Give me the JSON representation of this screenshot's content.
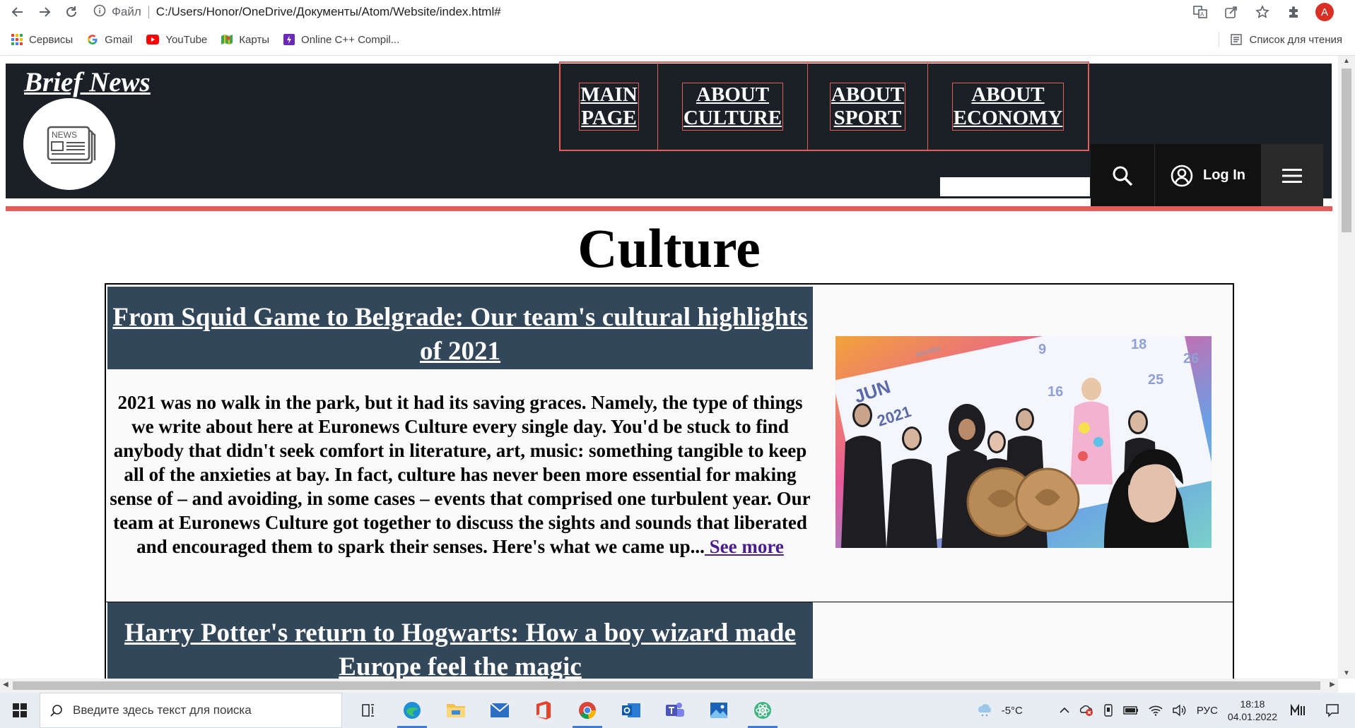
{
  "browser": {
    "file_label": "Файл",
    "url": "C:/Users/Honor/OneDrive/Документы/Atom/Website/index.html#",
    "avatar_letter": "A"
  },
  "bookmarks": {
    "items": [
      {
        "label": "Сервисы",
        "icon": "apps-grid-icon"
      },
      {
        "label": "Gmail",
        "icon": "google-icon"
      },
      {
        "label": "YouTube",
        "icon": "youtube-icon"
      },
      {
        "label": "Карты",
        "icon": "maps-icon"
      },
      {
        "label": "Online C++ Compil...",
        "icon": "compiler-icon"
      }
    ],
    "reading_list": "Список для чтения"
  },
  "site": {
    "brand": "Brief News",
    "logo_text": "NEWS",
    "menu": [
      {
        "label": "MAIN\nPAGE"
      },
      {
        "label": "ABOUT\nCULTURE"
      },
      {
        "label": "ABOUT\nSPORT"
      },
      {
        "label": "ABOUT\nECONOMY"
      }
    ],
    "login_label": "Log In",
    "accent_color": "#e35b5b",
    "header_color": "#1b2027"
  },
  "page": {
    "title": "Culture",
    "articles": [
      {
        "headline": "From Squid Game to Belgrade: Our team's cultural highlights of 2021",
        "body": "2021 was no walk in the park, but it had its saving graces. Namely, the type of things we write about here at Euronews Culture every single day. You'd be stuck to find anybody that didn't seek comfort in literature, art, music: something tangible to keep all of the anxieties at bay. In fact, culture has never been more essential for making sense of – and avoiding, in some cases – events that comprised one turbulent year. Our team at Euronews Culture got together to discuss the sights and sounds that liberated and encouraged them to spark their senses. Here's what we came up...",
        "link": " See more",
        "image_calendar_month": "JUN",
        "image_calendar_year": "2021",
        "image_weekday": "Monday",
        "image_days": [
          "9",
          "16",
          "18",
          "25",
          "26"
        ]
      },
      {
        "headline": "Harry Potter's return to Hogwarts: How a boy wizard made Europe feel the magic"
      }
    ]
  },
  "taskbar": {
    "search_placeholder": "Введите здесь текст для поиска",
    "weather": "-5°C",
    "language": "РУС",
    "time": "18:18",
    "date": "04.01.2022"
  }
}
